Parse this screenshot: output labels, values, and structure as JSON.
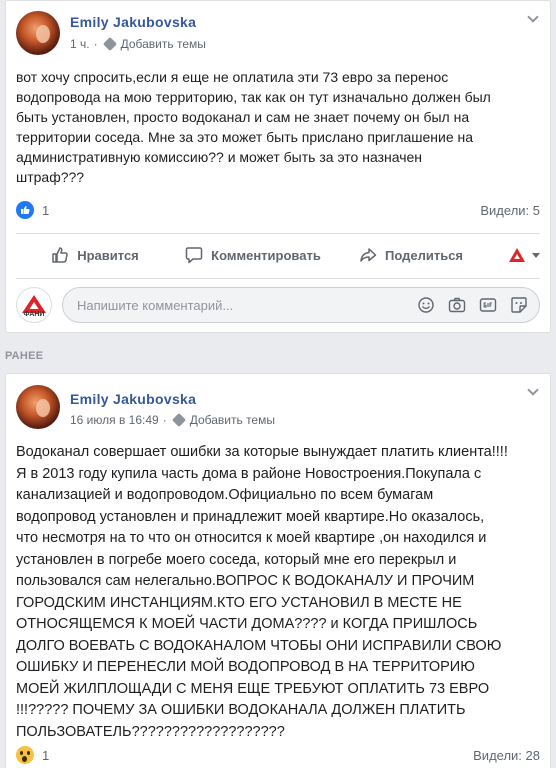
{
  "posts": [
    {
      "author": "Emily Jakubovska",
      "time": "1 ч.",
      "separator": "·",
      "add_topics": "Добавить темы",
      "text": "вот хочу спросить,если я еще не оплатила эти 73 евро за перенос\nводопровода на мою территорию, так как он тут изначально должен был\nбыть установлен, просто водоканал и сам не знает почему он был на\nтерритории соседа. Мне за это может быть прислано приглашение на\nадминистративную комиссию?? и может быть за это назначен\nштраф???",
      "reaction_count": "1",
      "views": "Видели: 5"
    },
    {
      "author": "Emily Jakubovska",
      "time": "16 июля в 16:49",
      "separator": "·",
      "add_topics": "Добавить темы",
      "text": "Водоканал совершает ошибки за которые вынуждает платить клиента!!!!\nЯ в 2013 году купила часть дома в районе Новостроения.Покупала с\nканализацией и водопроводом.Официально по всем бумагам\nводопровод установлен и принадлежит моей квартире.Но оказалось,\nчто несмотря на то что он относится к моей квартире ,он находился и\nустановлен в погребе моего соседа, который мне его перекрыл и\nпользовался сам нелегально.ВОПРОС К ВОДОКАНАЛУ И ПРОЧИМ\nГОРОДСКИМ ИНСТАНЦИЯМ.КТО ЕГО УСТАНОВИЛ В МЕСТЕ НЕ\nОТНОСЯЩЕМСЯ К МОЕЙ ЧАСТИ ДОМА???? и КОГДА ПРИШЛОСЬ\nДОЛГО ВОЕВАТЬ С ВОДОКАНАЛОМ ЧТОБЫ ОНИ ИСПРАВИЛИ СВОЮ\nОШИБКУ И ПЕРЕНЕСЛИ МОЙ ВОДОПРОВОД В НА ТЕРРИТОРИЮ\nМОЕЙ ЖИЛПЛОЩАДИ С МЕНЯ ЕЩЕ ТРЕБУЮТ ОПЛАТИТЬ 73 ЕВРО\n!!!????? ПОЧЕМУ ЗА ОШИБКИ ВОДОКАНАЛА ДОЛЖЕН ПЛАТИТЬ\nПОЛЬЗОВАТЕЛЬ???????????????????",
      "reaction_count": "1",
      "views": "Видели: 28"
    }
  ],
  "actions": {
    "like": "Нравится",
    "comment": "Комментировать",
    "share": "Поделиться"
  },
  "comment_box": {
    "placeholder": "Напишите комментарий...",
    "page_avatar_label": "ФАНИ"
  },
  "section_label": "РАНЕЕ",
  "icons": {
    "like_reaction": "thumbs-up-icon",
    "wow_reaction": "wow-icon",
    "emoji": "emoji-icon",
    "camera": "camera-icon",
    "gif": "gif-icon",
    "sticker": "sticker-icon",
    "tag": "tag-icon"
  },
  "colors": {
    "author": "#365899",
    "like_blue": "#2078f4",
    "brand_red": "#e0232a"
  }
}
